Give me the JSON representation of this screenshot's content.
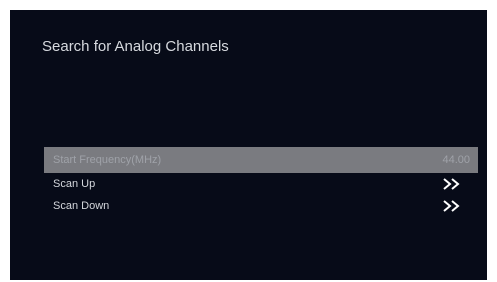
{
  "screen": {
    "title": "Search for Analog Channels"
  },
  "menu": {
    "items": [
      {
        "label": "Start Frequency(MHz)",
        "value": "44.00",
        "selected": true
      },
      {
        "label": "Scan Up",
        "icon": "double-chevron-right-icon"
      },
      {
        "label": "Scan Down",
        "icon": "double-chevron-right-icon"
      }
    ]
  },
  "colors": {
    "background": "#070b18",
    "highlight": "#7a7b80",
    "text": "#d4d7dc"
  }
}
